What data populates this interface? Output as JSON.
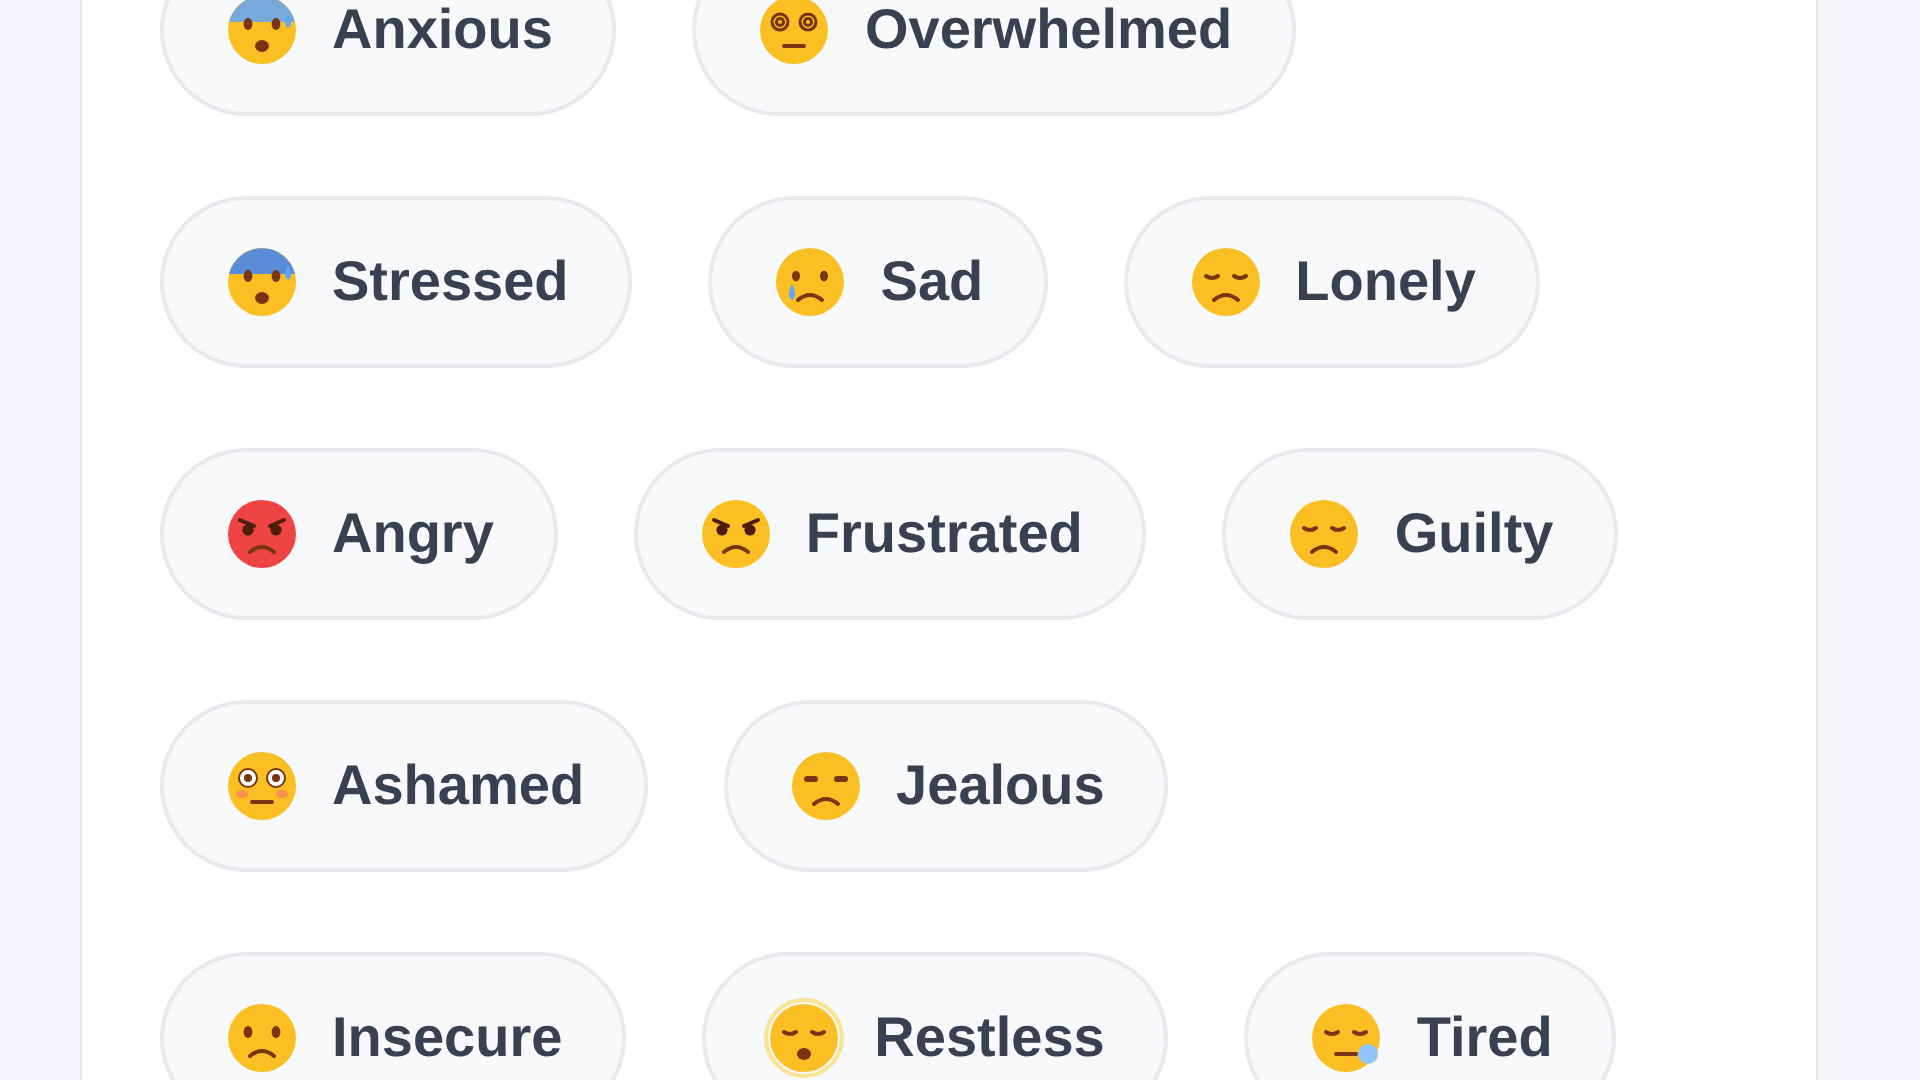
{
  "rows": [
    {
      "chips": [
        {
          "label": "Anxious",
          "kind": "anxious"
        },
        {
          "label": "Overwhelmed",
          "kind": "dizzy"
        }
      ]
    },
    {
      "chips": [
        {
          "label": "Stressed",
          "kind": "fearful"
        },
        {
          "label": "Sad",
          "kind": "tear"
        },
        {
          "label": "Lonely",
          "kind": "pensive"
        }
      ]
    },
    {
      "chips": [
        {
          "label": "Angry",
          "kind": "angry"
        },
        {
          "label": "Frustrated",
          "kind": "pout"
        },
        {
          "label": "Guilty",
          "kind": "disappointed"
        }
      ]
    },
    {
      "chips": [
        {
          "label": "Ashamed",
          "kind": "flushed"
        },
        {
          "label": "Jealous",
          "kind": "unamused"
        }
      ]
    },
    {
      "chips": [
        {
          "label": "Insecure",
          "kind": "worried"
        },
        {
          "label": "Restless",
          "kind": "shaking"
        },
        {
          "label": "Tired",
          "kind": "sleepy"
        }
      ]
    }
  ]
}
